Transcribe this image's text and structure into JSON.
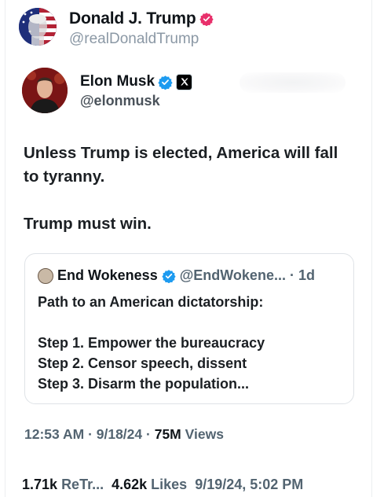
{
  "author": {
    "name": "Donald J. Trump",
    "handle": "@realDonaldTrump",
    "badge_color": "#e8306b"
  },
  "embedded_tweet": {
    "name": "Elon Musk",
    "handle": "@elonmusk",
    "badge_color": "#1d9bf0",
    "affiliate_icon": "x-logo-icon",
    "text_lines": [
      "Unless Trump is elected, America will fall to tyranny.",
      "Trump must win."
    ],
    "quote": {
      "name": "End Wokeness",
      "handle": "@EndWokene...",
      "time": "· 1d",
      "title": "Path to an American dictatorship:",
      "steps": [
        "Step 1. Empower the bureaucracy",
        "Step 2. Censor speech, dissent",
        "Step 3. Disarm the population..."
      ]
    },
    "meta": {
      "time": "12:53 AM",
      "date": "· 9/18/24 ·",
      "views_count": "75M",
      "views_label": "Views"
    }
  },
  "footer": {
    "retruths_count": "1.71k",
    "retruths_label": "ReTr...",
    "likes_count": "4.62k",
    "likes_label": "Likes",
    "datetime": "9/19/24, 5:02 PM"
  }
}
